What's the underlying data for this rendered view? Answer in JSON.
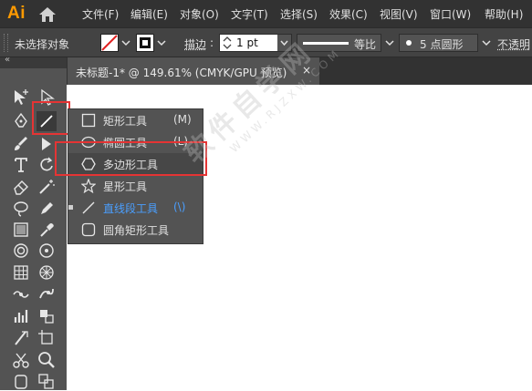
{
  "app": {
    "logo": "Ai"
  },
  "menubar": {
    "items": [
      {
        "label": "文件(F)"
      },
      {
        "label": "编辑(E)"
      },
      {
        "label": "对象(O)"
      },
      {
        "label": "文字(T)"
      },
      {
        "label": "选择(S)"
      },
      {
        "label": "效果(C)"
      },
      {
        "label": "视图(V)"
      },
      {
        "label": "窗口(W)"
      },
      {
        "label": "帮助(H)"
      }
    ]
  },
  "control_bar": {
    "selection_status": "未选择对象",
    "stroke_label": "描边",
    "stroke_colon": ":",
    "stroke_weight": "1 pt",
    "profile_label": "等比",
    "brush_label": "5 点圆形",
    "opacity_label": "不透明"
  },
  "document_tab": {
    "title": "未标题-1* @ 149.61% (CMYK/GPU 预览)",
    "close": "×"
  },
  "collapse_glyph": "«",
  "flyout": {
    "items": [
      {
        "label": "矩形工具",
        "shortcut": "(M)",
        "icon": "rectangle-icon",
        "active": false
      },
      {
        "label": "椭圆工具",
        "shortcut": "(L)",
        "icon": "ellipse-icon",
        "active": false
      },
      {
        "label": "多边形工具",
        "shortcut": "",
        "icon": "polygon-icon",
        "active": false
      },
      {
        "label": "星形工具",
        "shortcut": "",
        "icon": "star-icon",
        "active": false
      },
      {
        "label": "直线段工具",
        "shortcut": "(\\)",
        "icon": "line-segment-icon",
        "active": true
      },
      {
        "label": "圆角矩形工具",
        "shortcut": "",
        "icon": "rounded-rectangle-icon",
        "active": false
      }
    ]
  },
  "watermark": {
    "main": "软件自学网",
    "sub": "WWW.RJZXW.COM"
  },
  "colors": {
    "menubar_bg": "#323232",
    "panel_bg": "#535353",
    "control_bg": "#434343",
    "highlight_red": "#e53434",
    "active_blue": "#4a9fff",
    "logo_orange": "#ff9a00"
  }
}
